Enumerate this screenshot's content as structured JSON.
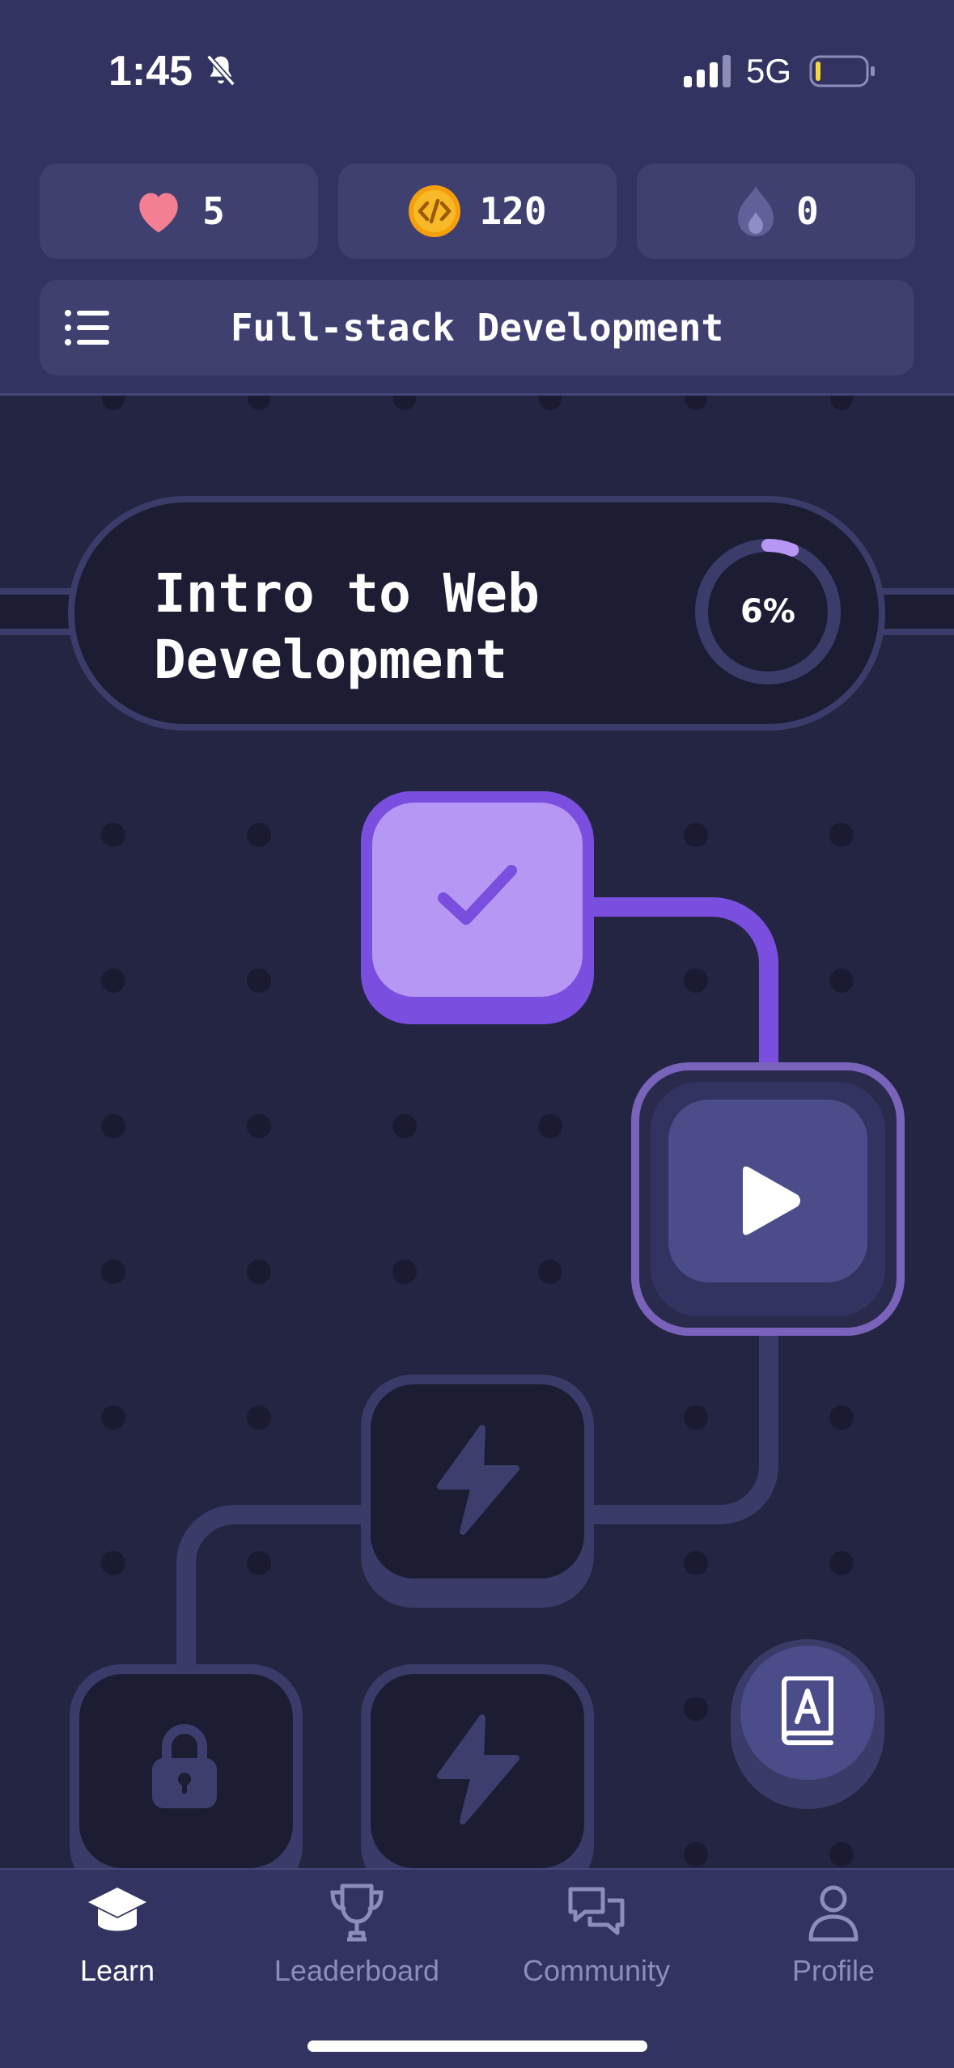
{
  "status_bar": {
    "time": "1:45",
    "network": "5G",
    "icons": [
      "bell-off-icon",
      "signal-icon",
      "battery-icon"
    ]
  },
  "stats": {
    "hearts": "5",
    "coins": "120",
    "streak": "0",
    "icons": [
      "heart-icon",
      "code-coin-icon",
      "flame-icon"
    ]
  },
  "course": {
    "title": "Full-stack Development",
    "menu_icon": "list-menu-icon"
  },
  "unit": {
    "title_line1": "Intro to Web",
    "title_line2": "Development",
    "progress_label": "6%",
    "progress": 0.06
  },
  "path_nodes": [
    {
      "state": "completed",
      "icon": "check-icon"
    },
    {
      "state": "current",
      "icon": "play-icon"
    },
    {
      "state": "locked",
      "icon": "lightning-icon"
    },
    {
      "state": "locked",
      "icon": "lock-icon"
    },
    {
      "state": "locked",
      "icon": "lightning-icon"
    }
  ],
  "fab": {
    "icon": "dictionary-icon"
  },
  "nav": {
    "items": [
      {
        "label": "Learn",
        "icon": "graduation-cap-icon",
        "active": true
      },
      {
        "label": "Leaderboard",
        "icon": "trophy-icon",
        "active": false
      },
      {
        "label": "Community",
        "icon": "chat-bubbles-icon",
        "active": false
      },
      {
        "label": "Profile",
        "icon": "person-icon",
        "active": false
      }
    ]
  },
  "colors": {
    "background": "#242543",
    "header": "#323360",
    "completed": "#b797f4",
    "accent": "#7a4ede",
    "heart": "#f47f92",
    "coin": "#f7b928"
  }
}
